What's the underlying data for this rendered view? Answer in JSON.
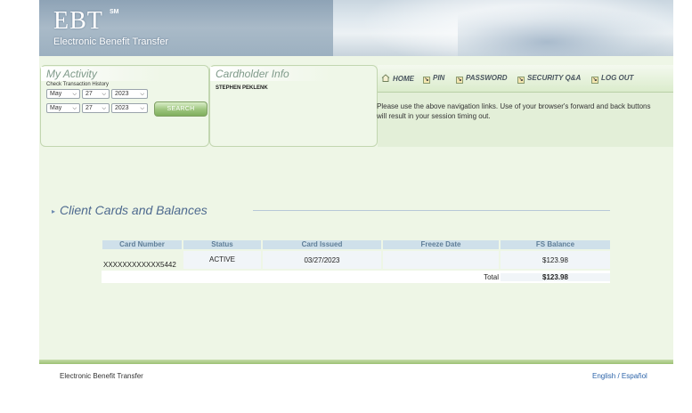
{
  "header": {
    "logo": "EBT",
    "logo_mark": "SM",
    "subtitle": "Electronic Benefit Transfer"
  },
  "my_activity": {
    "title": "My Activity",
    "label": "Check Transaction History",
    "from": {
      "month": "May",
      "day": "27",
      "year": "2023"
    },
    "to": {
      "month": "May",
      "day": "27",
      "year": "2023"
    },
    "search_label": "SEARCH"
  },
  "cardholder": {
    "title": "Cardholder Info",
    "name": "STEPHEN PEKLENK"
  },
  "nav": {
    "home": "HOME",
    "pin": "PIN",
    "password": "PASSWORD",
    "security": "SECURITY Q&A",
    "logout": "LOG OUT",
    "note": "Please use the above navigation links. Use of your browser's forward and back buttons will result in your session timing out."
  },
  "cards": {
    "title": "Client Cards and Balances",
    "columns": [
      "Card Number",
      "Status",
      "Card Issued",
      "Freeze Date",
      "FS Balance"
    ],
    "rows": [
      {
        "card_number": "XXXXXXXXXXXX5442",
        "status": "ACTIVE",
        "issued": "03/27/2023",
        "freeze": "",
        "balance": "$123.98"
      }
    ],
    "total_label": "Total",
    "total_value": "$123.98"
  },
  "footer": {
    "left": "Electronic Benefit Transfer",
    "english": "English",
    "sep": " / ",
    "spanish": "Español"
  }
}
